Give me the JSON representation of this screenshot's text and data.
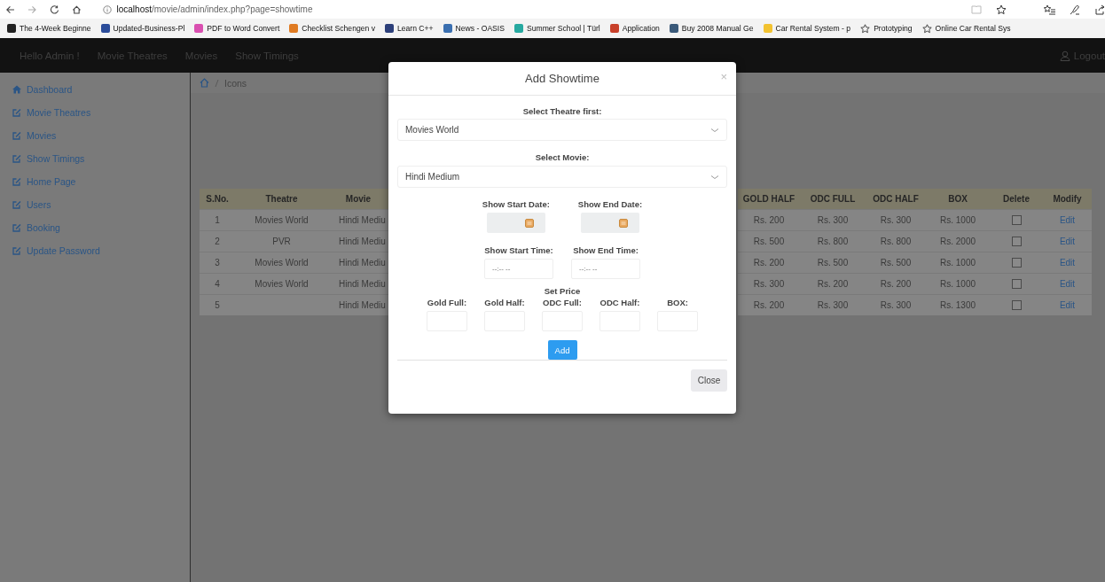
{
  "browser": {
    "url_host": "localhost",
    "url_path": "/movie/admin/index.php?page=showtime",
    "bookmarks": [
      {
        "label": "The 4-Week Beginne",
        "kind": "favicon",
        "color": "#222222"
      },
      {
        "label": "Updated-Business-Pl",
        "kind": "favicon",
        "color": "#2b4c9a"
      },
      {
        "label": "PDF to Word Convert",
        "kind": "favicon",
        "color": "#d94fb0"
      },
      {
        "label": "Checklist Schengen v",
        "kind": "favicon",
        "color": "#e07b22"
      },
      {
        "label": "Learn C++",
        "kind": "favicon",
        "color": "#2c3f7a"
      },
      {
        "label": "News - OASIS",
        "kind": "favicon",
        "color": "#3a6fb0"
      },
      {
        "label": "Summer School | Türl",
        "kind": "favicon",
        "color": "#26a9a0"
      },
      {
        "label": "Application",
        "kind": "favicon",
        "color": "#c8402a"
      },
      {
        "label": "Buy 2008 Manual Ge",
        "kind": "favicon",
        "color": "#3b5a7a"
      },
      {
        "label": "Car Rental System - p",
        "kind": "favicon",
        "color": "#f2c230"
      },
      {
        "label": "Prototyping",
        "kind": "star"
      },
      {
        "label": "Online Car Rental Sys",
        "kind": "star"
      }
    ]
  },
  "navbar": {
    "items": [
      "Hello Admin !",
      "Movie Theatres",
      "Movies",
      "Show Timings"
    ],
    "logout": "Logout"
  },
  "sidebar": {
    "items": [
      {
        "label": "Dashboard",
        "kind": "home"
      },
      {
        "label": "Movie Theatres",
        "kind": "edit"
      },
      {
        "label": "Movies",
        "kind": "edit"
      },
      {
        "label": "Show Timings",
        "kind": "edit"
      },
      {
        "label": "Home Page",
        "kind": "edit"
      },
      {
        "label": "Users",
        "kind": "edit"
      },
      {
        "label": "Booking",
        "kind": "edit"
      },
      {
        "label": "Update Password",
        "kind": "edit"
      }
    ]
  },
  "breadcrumb": {
    "current": "Icons"
  },
  "table": {
    "columns": [
      "S.No.",
      "Theatre",
      "Movie",
      "GOLD HALF",
      "ODC FULL",
      "ODC HALF",
      "BOX",
      "Delete",
      "Modify"
    ],
    "rows": [
      {
        "cells": [
          "1",
          "Movies World",
          "Hindi Mediu",
          "Rs. 200",
          "Rs. 300",
          "Rs. 300",
          "Rs. 1000"
        ],
        "delete_checked": false,
        "modify": "Edit"
      },
      {
        "cells": [
          "2",
          "PVR",
          "Hindi Mediu",
          "Rs. 500",
          "Rs. 800",
          "Rs. 800",
          "Rs. 2000"
        ],
        "delete_checked": false,
        "modify": "Edit"
      },
      {
        "cells": [
          "3",
          "Movies World",
          "Hindi Mediu",
          "Rs. 200",
          "Rs. 500",
          "Rs. 500",
          "Rs. 1000"
        ],
        "delete_checked": false,
        "modify": "Edit"
      },
      {
        "cells": [
          "4",
          "Movies World",
          "Hindi Mediu",
          "Rs. 300",
          "Rs. 200",
          "Rs. 200",
          "Rs. 1000"
        ],
        "delete_checked": false,
        "modify": "Edit"
      },
      {
        "cells": [
          "5",
          "",
          "Hindi Mediu",
          "Rs. 200",
          "Rs. 300",
          "Rs. 300",
          "Rs. 1300"
        ],
        "delete_checked": false,
        "modify": "Edit"
      }
    ]
  },
  "modal": {
    "title": "Add Showtime",
    "close_icon": "×",
    "theatre_label": "Select Theatre first:",
    "theatre_value": "Movies World",
    "movie_label": "Select Movie:",
    "movie_value": "Hindi Medium",
    "dates": [
      {
        "label": "Show Start Date:"
      },
      {
        "label": "Show End Date:"
      }
    ],
    "times": [
      {
        "label": "Show Start Time:",
        "placeholder": "--:-- --"
      },
      {
        "label": "Show End Time:",
        "placeholder": "--:-- --"
      }
    ],
    "price_heading": "Set Price",
    "prices": [
      "Gold Full:",
      "Gold Half:",
      "ODC Full:",
      "ODC Half:",
      "BOX:"
    ],
    "add_button": "Add",
    "close_button": "Close"
  }
}
